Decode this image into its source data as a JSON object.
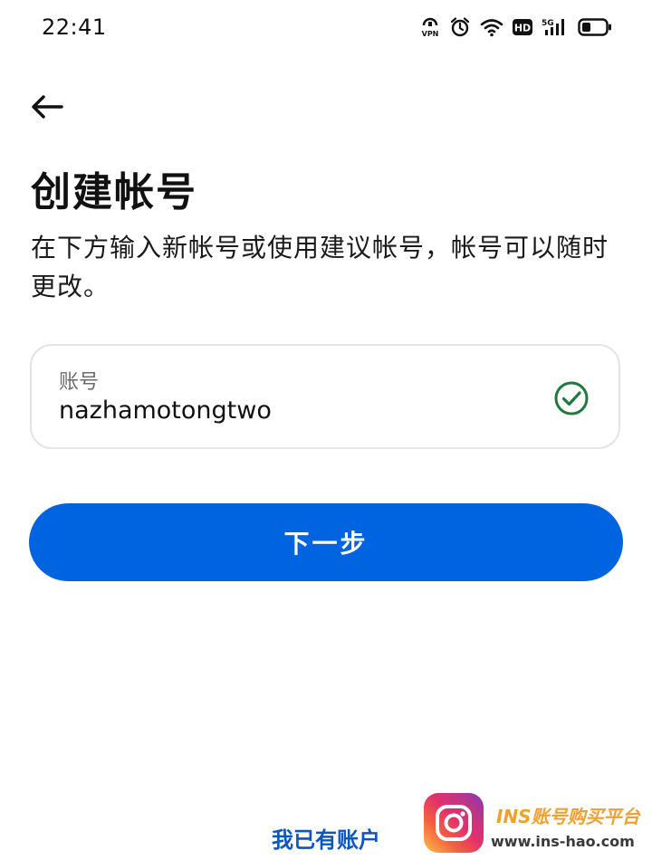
{
  "status_bar": {
    "time": "22:41",
    "vpn_label": "VPN",
    "hd_label": "HD",
    "network_label": "5G",
    "icons": [
      "vpn-icon",
      "alarm-icon",
      "wifi-icon",
      "hd-icon",
      "signal-5g-icon",
      "battery-icon"
    ]
  },
  "header": {
    "back_icon": "arrow-left-icon",
    "title": "创建帐号",
    "description": "在下方输入新帐号或使用建议帐号，帐号可以随时更改。"
  },
  "form": {
    "username": {
      "label": "账号",
      "value": "nazhamotongtwo",
      "valid": true,
      "status_icon": "check-circle-icon"
    },
    "next_label": "下一步"
  },
  "footer": {
    "have_account_label": "我已有账户"
  },
  "watermark": {
    "title": "INS账号购买平台",
    "url": "www.ins-hao.com",
    "logo_icon": "instagram-logo-icon"
  },
  "colors": {
    "primary": "#0064e0",
    "link": "#0a57c2",
    "success": "#1e7a3a",
    "field_border": "#e4e4e4"
  }
}
